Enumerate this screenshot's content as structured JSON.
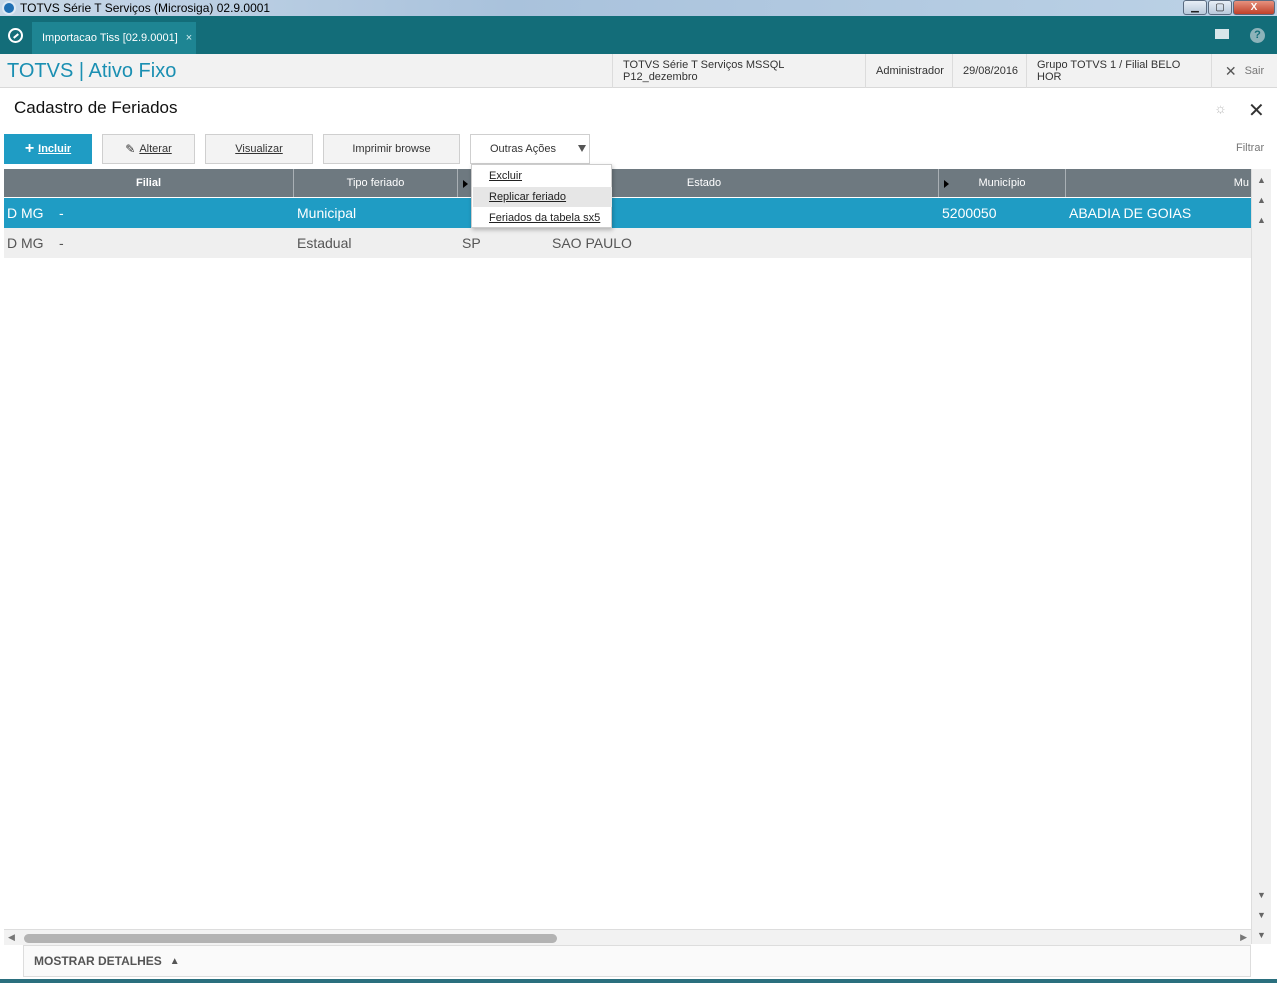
{
  "window": {
    "title": "TOTVS Série T Serviços (Microsiga) 02.9.0001",
    "controls": [
      "▁",
      "▢",
      "X"
    ]
  },
  "tabbar": {
    "tab_label": "Importacao Tiss [02.9.0001]",
    "tab_close": "×",
    "help_label": "?"
  },
  "header": {
    "brand": "TOTVS | Ativo Fixo",
    "environment": "TOTVS Série T Serviços MSSQL P12_dezembro",
    "user": "Administrador",
    "date": "29/08/2016",
    "company": "Grupo TOTVS 1 / Filial BELO HOR",
    "logout_icon": "✕",
    "logout_label": "Sair"
  },
  "page": {
    "title": "Cadastro de Feriados",
    "close_icon": "✕",
    "settings_icon": "☼"
  },
  "toolbar": {
    "incluir_icon": "+",
    "incluir": "Incluir",
    "alterar_icon": "✎",
    "alterar": "Alterar",
    "visualizar": "Visualizar",
    "imprimir": "Imprimir browse",
    "outras": "Outras Ações",
    "filtrar": "Filtrar"
  },
  "menu": {
    "items": [
      "Excluir",
      "Replicar feriado",
      "Feriados da tabela sx5"
    ]
  },
  "grid": {
    "headers": {
      "filial": "Filial",
      "tipo": "Tipo feriado",
      "estado": "Estado",
      "municipio": "Município",
      "mun_desc": "Mu"
    },
    "rows": [
      {
        "filial": "D MG",
        "sep": "-",
        "tipo": "Municipal",
        "uf": "",
        "estado": "",
        "municipio": "5200050",
        "mun_desc": "ABADIA DE GOIAS",
        "selected": true
      },
      {
        "filial": "D MG",
        "sep": "-",
        "tipo": "Estadual",
        "uf": "SP",
        "estado": "SAO PAULO",
        "municipio": "",
        "mun_desc": "",
        "selected": false
      }
    ]
  },
  "scroll": {
    "up": "▲",
    "down": "▼",
    "left": "◀",
    "right": "▶"
  },
  "details": {
    "label": "MOSTRAR DETALHES",
    "toggle": "▲"
  },
  "colors": {
    "accent": "#1f9cc4",
    "tabbar": "#136d79",
    "grid_header": "#6e7980",
    "brand": "#1a8fb2"
  }
}
